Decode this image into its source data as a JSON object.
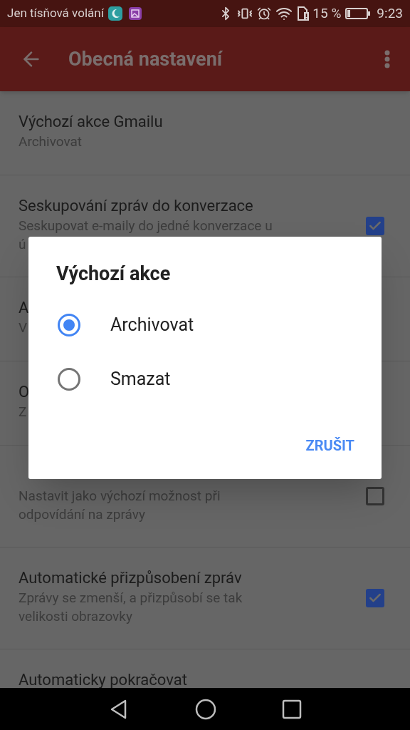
{
  "status_bar": {
    "carrier": "Jen tísňová volání",
    "battery": "15 %",
    "time": "9:23"
  },
  "app_bar": {
    "title": "Obecná nastavení"
  },
  "settings": [
    {
      "title": "Výchozí akce Gmailu",
      "summary": [
        "Archivovat"
      ],
      "kind": "plain"
    },
    {
      "title": "Seskupování zpráv do konverzace",
      "summary": [
        "Seskupovat e-maily do jedné konverzace u",
        "ú"
      ],
      "kind": "checkbox",
      "checked": true
    },
    {
      "title": "A",
      "summary": [
        "V"
      ],
      "kind": "plain"
    },
    {
      "title": "O",
      "summary": [
        "Z"
      ],
      "kind": "plain"
    },
    {
      "summary": [
        "Nastavit jako výchozí možnost při",
        "odpovídání na zprávy"
      ],
      "kind": "checkbox",
      "checked": false
    },
    {
      "title": "Automatické přizpůsobení zpráv",
      "summary": [
        "Zprávy se zmenší, a přizpůsobí se tak",
        "velikosti obrazovky"
      ],
      "kind": "checkbox",
      "checked": true
    },
    {
      "title": "Automaticky pokračovat",
      "kind": "plain"
    }
  ],
  "dialog": {
    "title": "Výchozí akce",
    "options": [
      {
        "label": "Archivovat",
        "selected": true
      },
      {
        "label": "Smazat",
        "selected": false
      }
    ],
    "button": "ZRUŠIT"
  }
}
